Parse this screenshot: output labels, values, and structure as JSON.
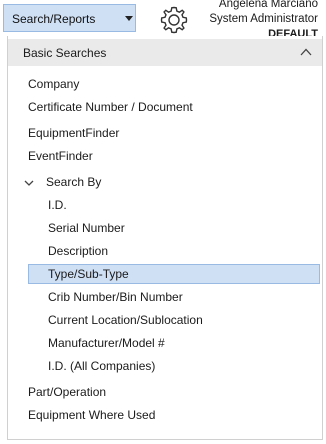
{
  "toolbar": {
    "dropdown_label": "Search/Reports",
    "user_name": "Angelena Marciano",
    "user_role": "System Administrator",
    "company": "DEFAULT"
  },
  "panel": {
    "section_title": "Basic Searches",
    "items": [
      "Company",
      "Certificate Number / Document",
      "EquipmentFinder",
      "EventFinder"
    ],
    "group_label": "Search By",
    "group_items": [
      "I.D.",
      "Serial Number",
      "Description",
      "Type/Sub-Type",
      "Crib Number/Bin Number",
      "Current Location/Sublocation",
      "Manufacturer/Model #",
      "I.D. (All Companies)"
    ],
    "selected_item": "Type/Sub-Type",
    "trailing_items": [
      "Part/Operation",
      "Equipment Where Used"
    ]
  },
  "colors": {
    "accent": "#cfe0f5",
    "accent_border": "#99bbe3",
    "header_bg": "#eaeaea"
  }
}
